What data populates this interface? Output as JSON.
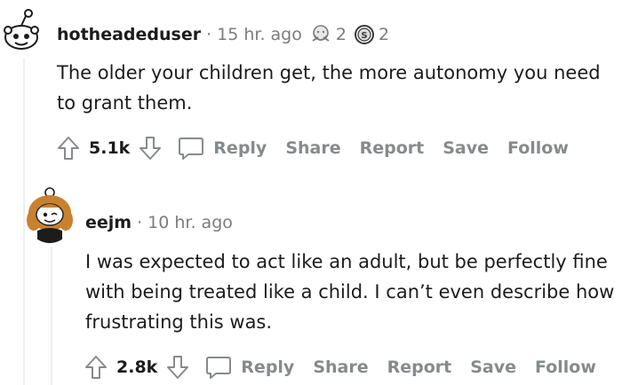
{
  "comments": [
    {
      "username": "hotheadeduser",
      "separator": "·",
      "time": "15 hr. ago",
      "awards": [
        {
          "icon": "hug-award-icon",
          "count": "2"
        },
        {
          "icon": "silver-award-icon",
          "count": "2"
        }
      ],
      "body": "The older your children get, the more autonomy you need to grant them.",
      "score": "5.1k",
      "actions": {
        "reply": "Reply",
        "share": "Share",
        "report": "Report",
        "save": "Save",
        "follow": "Follow"
      }
    },
    {
      "username": "eejm",
      "separator": "·",
      "time": "10 hr. ago",
      "body": "I was expected to act like an adult, but be perfectly fine with being treated like a child. I can’t even describe how frustrating this was.",
      "score": "2.8k",
      "actions": {
        "reply": "Reply",
        "share": "Share",
        "report": "Report",
        "save": "Save",
        "follow": "Follow"
      }
    }
  ],
  "colors": {
    "meta_gray": "#7c7c7c",
    "action_gray": "#878a8c",
    "text": "#1c1c1c",
    "thread_line": "#edeff1"
  }
}
